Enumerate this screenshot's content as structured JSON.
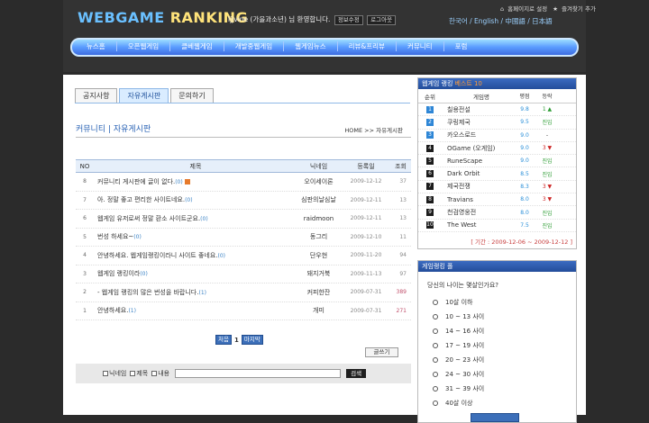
{
  "header": {
    "logo_part1": "WEBGAME",
    "logo_part2": "RANKING",
    "welcome": "ljjvine (가을과소년) 님 환영합니다.",
    "info_edit": "정보수정",
    "logout": "로그아웃",
    "set_homepage": "홈페이지로 설정",
    "add_favorite": "즐겨찾기 추가",
    "languages": "한국어 / English / 中國語 / 日本語"
  },
  "nav": [
    "뉴스홈",
    "오픈웹게임",
    "클베웹게임",
    "개발중웹게임",
    "웹게임뉴스",
    "리뷰&프리뷰",
    "커뮤니티",
    "포럼"
  ],
  "tabs": [
    "공지사항",
    "자유게시판",
    "문의하기"
  ],
  "page_title": "커뮤니티 | 자유게시판",
  "breadcrumb": "HOME >> 자유게시판",
  "board": {
    "headers": {
      "no": "NO",
      "title": "제목",
      "author": "닉네임",
      "date": "등록일",
      "views": "조회"
    },
    "rows": [
      {
        "no": "8",
        "title": "커뮤니티 게시판에 글이 없다.",
        "comments": "(0)",
        "new": true,
        "author": "오이세이론",
        "date": "2009-12-12",
        "views": "37"
      },
      {
        "no": "7",
        "title": "아. 정말 좋고 편리한 사이트네요.",
        "comments": "(0)",
        "new": false,
        "author": "심판의날심날",
        "date": "2009-12-11",
        "views": "13"
      },
      {
        "no": "6",
        "title": "웹게임 유저로써 정말 환소 사이트군요.",
        "comments": "(0)",
        "new": false,
        "author": "raidmoon",
        "date": "2009-12-11",
        "views": "13"
      },
      {
        "no": "5",
        "title": "번성 하세요~",
        "comments": "(0)",
        "new": false,
        "author": "동그리",
        "date": "2009-12-10",
        "views": "11"
      },
      {
        "no": "4",
        "title": "안녕하세요. 웹게임랭킹이라니 사이트 좋네요.",
        "comments": "(0)",
        "new": false,
        "author": "단우현",
        "date": "2009-11-20",
        "views": "94"
      },
      {
        "no": "3",
        "title": "웹게임 랭킹이라",
        "comments": "(0)",
        "new": false,
        "author": "돼지거북",
        "date": "2009-11-13",
        "views": "97"
      },
      {
        "no": "2",
        "title": "- 웹게임 랭킹의 많은 번성을 바랍니다.",
        "comments": "(1)",
        "new": false,
        "author": "커피한잔",
        "date": "2009-07-31",
        "views": "389"
      },
      {
        "no": "1",
        "title": "안녕하세요.",
        "comments": "(1)",
        "new": false,
        "author": "개미",
        "date": "2009-07-31",
        "views": "271"
      }
    ]
  },
  "pager": {
    "first": "처음",
    "current": "1",
    "last": "마지막"
  },
  "write_button": "글쓰기",
  "search": {
    "opt_nick": "닉네임",
    "opt_title": "제목",
    "opt_content": "내용",
    "button": "검색"
  },
  "ranking": {
    "title": "웹게임 랭킹",
    "title_accent": "베스트 10",
    "headers": {
      "rank": "순위",
      "name": "게임명",
      "score": "평점",
      "change": "등락"
    },
    "items": [
      {
        "rank": "1",
        "name": "칠용전설",
        "score": "9.8",
        "change": "1 ▲",
        "dir": "up"
      },
      {
        "rank": "2",
        "name": "쿠링제국",
        "score": "9.5",
        "change": "진입",
        "dir": "up"
      },
      {
        "rank": "3",
        "name": "카오스로드",
        "score": "9.0",
        "change": "-",
        "dir": "none"
      },
      {
        "rank": "4",
        "name": "OGame (오게임)",
        "score": "9.0",
        "change": "3 ▼",
        "dir": "down"
      },
      {
        "rank": "5",
        "name": "RuneScape",
        "score": "9.0",
        "change": "진입",
        "dir": "up"
      },
      {
        "rank": "6",
        "name": "Dark Orbit",
        "score": "8.5",
        "change": "진입",
        "dir": "up"
      },
      {
        "rank": "7",
        "name": "제국전쟁",
        "score": "8.3",
        "change": "3 ▼",
        "dir": "down"
      },
      {
        "rank": "8",
        "name": "Travians",
        "score": "8.0",
        "change": "3 ▼",
        "dir": "down"
      },
      {
        "rank": "9",
        "name": "천검영웅전",
        "score": "8.0",
        "change": "진입",
        "dir": "up"
      },
      {
        "rank": "10",
        "name": "The West",
        "score": "7.5",
        "change": "진입",
        "dir": "up"
      }
    ],
    "period": "[ 기간 : 2009-12-06 ~ 2009-12-12 ]"
  },
  "poll": {
    "title": "게임랭킹 폴",
    "question": "당신의 나이는 몇살인가요?",
    "options": [
      "10살 이하",
      "10 ~ 13 사이",
      "14 ~ 16 사이",
      "17 ~ 19 사이",
      "20 ~ 23 사이",
      "24 ~ 30 사이",
      "31 ~ 39 사이",
      "40살 이상"
    ]
  },
  "colors": {
    "accent": "#2a63b5",
    "nav_blue": "#5a9bff",
    "ranking_orange": "#ff9c37"
  }
}
